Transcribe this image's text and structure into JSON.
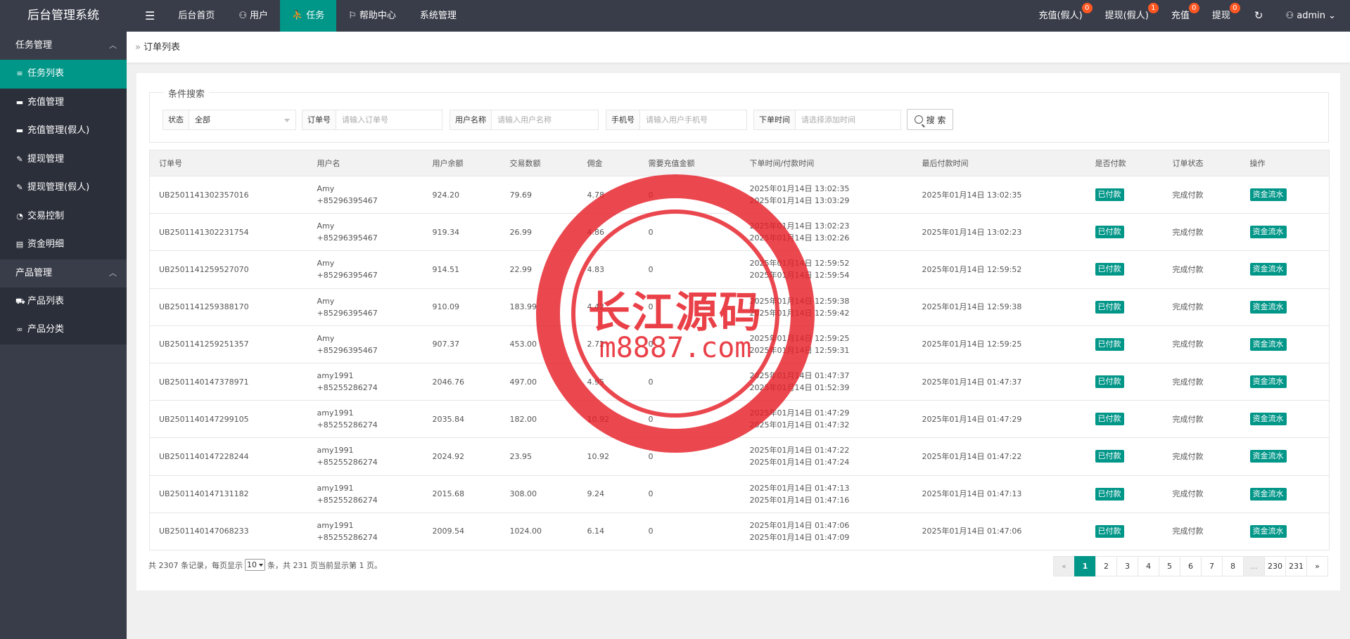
{
  "app": {
    "title": "后台管理系统"
  },
  "topnav": {
    "menu_icon": "menu-icon",
    "items": [
      {
        "label": "后台首页",
        "icon": ""
      },
      {
        "label": "用户",
        "icon": "user-icon"
      },
      {
        "label": "任务",
        "icon": "walk-icon",
        "active": true
      },
      {
        "label": "帮助中心",
        "icon": "flag-icon"
      },
      {
        "label": "系统管理",
        "icon": ""
      }
    ]
  },
  "topright": {
    "items": [
      {
        "label": "充值(假人)",
        "badge": "0"
      },
      {
        "label": "提现(假人)",
        "badge": "1"
      },
      {
        "label": "充值",
        "badge": "0"
      },
      {
        "label": "提现",
        "badge": "0"
      }
    ],
    "refresh_icon": "refresh-icon",
    "admin": "admin"
  },
  "sidebar": {
    "groups": [
      {
        "label": "任务管理",
        "items": [
          {
            "label": "任务列表",
            "icon": "list-icon",
            "glyph": "≡",
            "active": true
          },
          {
            "label": "充值管理",
            "icon": "money-icon",
            "glyph": "▬"
          },
          {
            "label": "充值管理(假人)",
            "icon": "money-icon",
            "glyph": "▬"
          },
          {
            "label": "提现管理",
            "icon": "gavel-icon",
            "glyph": "✎"
          },
          {
            "label": "提现管理(假人)",
            "icon": "gavel-icon",
            "glyph": "✎"
          },
          {
            "label": "交易控制",
            "icon": "dashboard-icon",
            "glyph": "◔"
          },
          {
            "label": "资金明细",
            "icon": "ledger-icon",
            "glyph": "▤"
          }
        ]
      },
      {
        "label": "产品管理",
        "items": [
          {
            "label": "产品列表",
            "icon": "cart-icon",
            "glyph": "⛟"
          },
          {
            "label": "产品分类",
            "icon": "link-icon",
            "glyph": "∞"
          }
        ]
      }
    ]
  },
  "breadcrumb": {
    "current": "订单列表"
  },
  "search": {
    "legend": "条件搜索",
    "status": {
      "label": "状态",
      "value": "全部"
    },
    "order_no": {
      "label": "订单号",
      "placeholder": "请输入订单号"
    },
    "username": {
      "label": "用户名称",
      "placeholder": "请输入用户名称"
    },
    "phone": {
      "label": "手机号",
      "placeholder": "请输入用户手机号"
    },
    "order_time": {
      "label": "下单时间",
      "placeholder": "请选择添加时间"
    },
    "button": "搜 索"
  },
  "table": {
    "headers": [
      "订单号",
      "用户名",
      "用户余额",
      "交易数额",
      "佣金",
      "需要充值金额",
      "下单时间/付款时间",
      "最后付款时间",
      "是否付款",
      "订单状态",
      "操作"
    ],
    "rows": [
      {
        "order_no": "UB2501141302357016",
        "user": "Amy",
        "phone": "+85296395467",
        "balance": "924.20",
        "amount": "79.69",
        "commission": "4.78",
        "recharge": "0",
        "order_time": "2025年01月14日 13:02:35",
        "pay_time": "2025年01月14日 13:03:29",
        "last_pay": "2025年01月14日 13:02:35",
        "paid": "已付款",
        "status": "完成付款",
        "action": "资金流水"
      },
      {
        "order_no": "UB2501141302231754",
        "user": "Amy",
        "phone": "+85296395467",
        "balance": "919.34",
        "amount": "26.99",
        "commission": "4.86",
        "recharge": "0",
        "order_time": "2025年01月14日 13:02:23",
        "pay_time": "2025年01月14日 13:02:26",
        "last_pay": "2025年01月14日 13:02:23",
        "paid": "已付款",
        "status": "完成付款",
        "action": "资金流水"
      },
      {
        "order_no": "UB2501141259527070",
        "user": "Amy",
        "phone": "+85296395467",
        "balance": "914.51",
        "amount": "22.99",
        "commission": "4.83",
        "recharge": "0",
        "order_time": "2025年01月14日 12:59:52",
        "pay_time": "2025年01月14日 12:59:54",
        "last_pay": "2025年01月14日 12:59:52",
        "paid": "已付款",
        "status": "完成付款",
        "action": "资金流水"
      },
      {
        "order_no": "UB2501141259388170",
        "user": "Amy",
        "phone": "+85296395467",
        "balance": "910.09",
        "amount": "183.99",
        "commission": "4.42",
        "recharge": "0",
        "order_time": "2025年01月14日 12:59:38",
        "pay_time": "2025年01月14日 12:59:42",
        "last_pay": "2025年01月14日 12:59:38",
        "paid": "已付款",
        "status": "完成付款",
        "action": "资金流水"
      },
      {
        "order_no": "UB2501141259251357",
        "user": "Amy",
        "phone": "+85296395467",
        "balance": "907.37",
        "amount": "453.00",
        "commission": "2.72",
        "recharge": "0",
        "order_time": "2025年01月14日 12:59:25",
        "pay_time": "2025年01月14日 12:59:31",
        "last_pay": "2025年01月14日 12:59:25",
        "paid": "已付款",
        "status": "完成付款",
        "action": "资金流水"
      },
      {
        "order_no": "UB2501140147378971",
        "user": "amy1991",
        "phone": "+85255286274",
        "balance": "2046.76",
        "amount": "497.00",
        "commission": "4.95",
        "recharge": "0",
        "order_time": "2025年01月14日 01:47:37",
        "pay_time": "2025年01月14日 01:52:39",
        "last_pay": "2025年01月14日 01:47:37",
        "paid": "已付款",
        "status": "完成付款",
        "action": "资金流水"
      },
      {
        "order_no": "UB2501140147299105",
        "user": "amy1991",
        "phone": "+85255286274",
        "balance": "2035.84",
        "amount": "182.00",
        "commission": "10.92",
        "recharge": "0",
        "order_time": "2025年01月14日 01:47:29",
        "pay_time": "2025年01月14日 01:47:32",
        "last_pay": "2025年01月14日 01:47:29",
        "paid": "已付款",
        "status": "完成付款",
        "action": "资金流水"
      },
      {
        "order_no": "UB2501140147228244",
        "user": "amy1991",
        "phone": "+85255286274",
        "balance": "2024.92",
        "amount": "23.95",
        "commission": "10.92",
        "recharge": "0",
        "order_time": "2025年01月14日 01:47:22",
        "pay_time": "2025年01月14日 01:47:24",
        "last_pay": "2025年01月14日 01:47:22",
        "paid": "已付款",
        "status": "完成付款",
        "action": "资金流水"
      },
      {
        "order_no": "UB2501140147131182",
        "user": "amy1991",
        "phone": "+85255286274",
        "balance": "2015.68",
        "amount": "308.00",
        "commission": "9.24",
        "recharge": "0",
        "order_time": "2025年01月14日 01:47:13",
        "pay_time": "2025年01月14日 01:47:16",
        "last_pay": "2025年01月14日 01:47:13",
        "paid": "已付款",
        "status": "完成付款",
        "action": "资金流水"
      },
      {
        "order_no": "UB2501140147068233",
        "user": "amy1991",
        "phone": "+85255286274",
        "balance": "2009.54",
        "amount": "1024.00",
        "commission": "6.14",
        "recharge": "0",
        "order_time": "2025年01月14日 01:47:06",
        "pay_time": "2025年01月14日 01:47:09",
        "last_pay": "2025年01月14日 01:47:06",
        "paid": "已付款",
        "status": "完成付款",
        "action": "资金流水"
      }
    ]
  },
  "footer": {
    "summary_prefix": "共 2307 条记录，每页显示",
    "page_size": "10",
    "summary_suffix": "条，共 231 页当前显示第 1 页。"
  },
  "pager": {
    "prev": "«",
    "pages": [
      "1",
      "2",
      "3",
      "4",
      "5",
      "6",
      "7",
      "8",
      "...",
      "230",
      "231"
    ],
    "active": "1",
    "next": "»"
  },
  "watermark": {
    "line1": "长江源码",
    "line2": "m8887.com"
  },
  "colors": {
    "accent": "#009688",
    "nav_bg": "#393d49",
    "sub_bg": "#2b2f3a",
    "badge": "#ff5722",
    "watermark": "#e61e28"
  }
}
